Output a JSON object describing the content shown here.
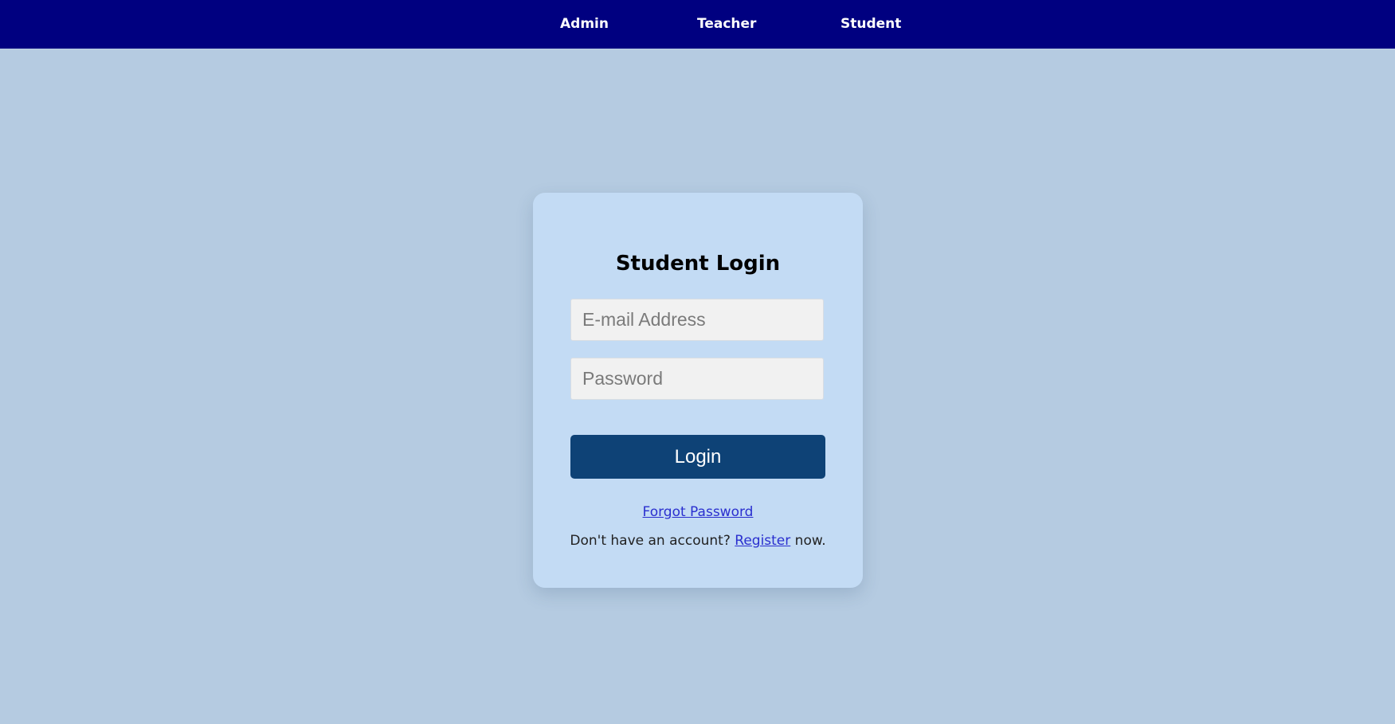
{
  "nav": {
    "items": [
      {
        "label": "Admin"
      },
      {
        "label": "Teacher"
      },
      {
        "label": "Student"
      }
    ]
  },
  "login": {
    "title": "Student Login",
    "email": {
      "value": "",
      "placeholder": "E-mail Address"
    },
    "password": {
      "value": "",
      "placeholder": "Password"
    },
    "submit_label": "Login",
    "forgot_label": "Forgot Password",
    "register_prefix": "Don't have an account? ",
    "register_link": "Register",
    "register_suffix": " now."
  },
  "colors": {
    "page_background": "#b5cbe1",
    "navbar": "#000080",
    "card": "#c3dbf4",
    "button": "#0e4276",
    "link": "#2a2fcf"
  }
}
